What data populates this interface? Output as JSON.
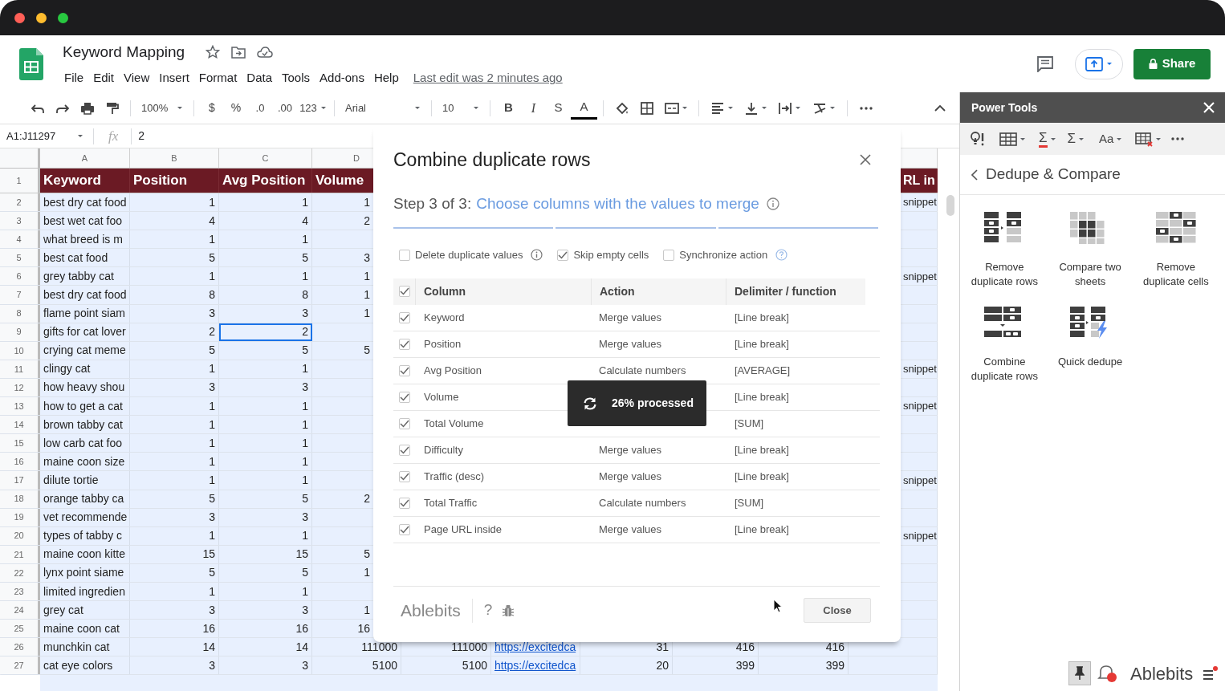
{
  "document": {
    "title": "Keyword Mapping",
    "menu": [
      "File",
      "Edit",
      "View",
      "Insert",
      "Format",
      "Data",
      "Tools",
      "Add-ons",
      "Help"
    ],
    "last_edit": "Last edit was 2 minutes ago",
    "share": "Share"
  },
  "toolbar": {
    "zoom": "100%",
    "currency": "$",
    "percent": "%",
    "decrease_decimals": ".0",
    "increase_decimals": ".00",
    "number_format": "123",
    "font": "Arial",
    "font_size": "10",
    "bold": "B",
    "italic": "I",
    "strikethrough": "S",
    "text_color": "A"
  },
  "formula_bar": {
    "name_box": "A1:J11297",
    "fx": "fx",
    "formula": "2"
  },
  "sheet": {
    "columns": [
      "A",
      "B",
      "C",
      "D"
    ],
    "header_row": {
      "number": "1",
      "cells": {
        "A": "Keyword",
        "B": "Position",
        "C": "Avg Position",
        "D": "Volume",
        "J": "RL in"
      }
    },
    "rows": [
      {
        "number": "2",
        "selected": false,
        "cells": {
          "A": "best dry cat food",
          "B": "1",
          "C": "1",
          "D": "1",
          "J": "snippet"
        }
      },
      {
        "number": "3",
        "selected": false,
        "cells": {
          "A": "best wet cat foo",
          "B": "4",
          "C": "4",
          "D": "2"
        }
      },
      {
        "number": "4",
        "selected": false,
        "cells": {
          "A": "what breed is m",
          "B": "1",
          "C": "1"
        }
      },
      {
        "number": "5",
        "selected": false,
        "cells": {
          "A": "best cat food",
          "B": "5",
          "C": "5",
          "D": "3"
        }
      },
      {
        "number": "6",
        "selected": false,
        "cells": {
          "A": "grey tabby cat",
          "B": "1",
          "C": "1",
          "D": "1",
          "J": "snippet"
        }
      },
      {
        "number": "7",
        "selected": false,
        "cells": {
          "A": "best dry cat food",
          "B": "8",
          "C": "8",
          "D": "1"
        }
      },
      {
        "number": "8",
        "selected": false,
        "cells": {
          "A": "flame point siam",
          "B": "3",
          "C": "3",
          "D": "1"
        }
      },
      {
        "number": "9",
        "selected": true,
        "cells": {
          "A": "gifts for cat lover",
          "B": "2",
          "C": "2"
        }
      },
      {
        "number": "10",
        "selected": false,
        "cells": {
          "A": "crying cat meme",
          "B": "5",
          "C": "5",
          "D": "5"
        }
      },
      {
        "number": "11",
        "selected": false,
        "cells": {
          "A": "clingy cat",
          "B": "1",
          "C": "1",
          "J": "snippet"
        }
      },
      {
        "number": "12",
        "selected": false,
        "cells": {
          "A": "how heavy shou",
          "B": "3",
          "C": "3"
        }
      },
      {
        "number": "13",
        "selected": false,
        "cells": {
          "A": "how to get a cat",
          "B": "1",
          "C": "1",
          "J": "snippet"
        }
      },
      {
        "number": "14",
        "selected": false,
        "cells": {
          "A": "brown tabby cat",
          "B": "1",
          "C": "1"
        }
      },
      {
        "number": "15",
        "selected": false,
        "cells": {
          "A": "low carb cat foo",
          "B": "1",
          "C": "1"
        }
      },
      {
        "number": "16",
        "selected": false,
        "cells": {
          "A": "maine coon size",
          "B": "1",
          "C": "1"
        }
      },
      {
        "number": "17",
        "selected": false,
        "cells": {
          "A": "dilute tortie",
          "B": "1",
          "C": "1",
          "J": "snippet"
        }
      },
      {
        "number": "18",
        "selected": false,
        "cells": {
          "A": "orange tabby ca",
          "B": "5",
          "C": "5",
          "D": "2"
        }
      },
      {
        "number": "19",
        "selected": false,
        "cells": {
          "A": "vet recommende",
          "B": "3",
          "C": "3"
        }
      },
      {
        "number": "20",
        "selected": false,
        "cells": {
          "A": "types of tabby c",
          "B": "1",
          "C": "1",
          "J": "snippet"
        }
      },
      {
        "number": "21",
        "selected": false,
        "cells": {
          "A": "maine coon kitte",
          "B": "15",
          "C": "15",
          "D": "5"
        }
      },
      {
        "number": "22",
        "selected": false,
        "cells": {
          "A": "lynx point siame",
          "B": "5",
          "C": "5",
          "D": "1"
        }
      },
      {
        "number": "23",
        "selected": false,
        "cells": {
          "A": "limited ingredien",
          "B": "1",
          "C": "1"
        }
      },
      {
        "number": "24",
        "selected": false,
        "cells": {
          "A": "grey cat",
          "B": "3",
          "C": "3",
          "D": "1"
        }
      },
      {
        "number": "25",
        "selected": false,
        "cells": {
          "A": "maine coon cat",
          "B": "16",
          "C": "16",
          "D": "16"
        }
      },
      {
        "number": "26",
        "selected": false,
        "cells": {
          "A": "munchkin cat",
          "B": "14",
          "C": "14",
          "D": "111000",
          "E": "111000",
          "F": "https://excitedca",
          "G": "31",
          "H": "416",
          "I": "416"
        }
      },
      {
        "number": "27",
        "selected": false,
        "cells": {
          "A": "cat eye colors",
          "B": "3",
          "C": "3",
          "D": "5100",
          "E": "5100",
          "F": "https://excitedca",
          "G": "20",
          "H": "399",
          "I": "399"
        }
      }
    ]
  },
  "dialog": {
    "title": "Combine duplicate rows",
    "step": "Step 3 of 3:",
    "step_title": "Choose columns with the values to merge",
    "options": [
      {
        "label": "Delete duplicate values",
        "checked": false,
        "kind": "info"
      },
      {
        "label": "Skip empty cells",
        "checked": true,
        "kind": "plain"
      },
      {
        "label": "Synchronize action",
        "checked": false,
        "kind": "help"
      }
    ],
    "columns": [
      "Column",
      "Action",
      "Delimiter / function"
    ],
    "all_checked": true,
    "rows": [
      {
        "column": "Keyword",
        "action": "Merge values",
        "delimiter": "[Line break]",
        "checked": true
      },
      {
        "column": "Position",
        "action": "Merge values",
        "delimiter": "[Line break]",
        "checked": true
      },
      {
        "column": "Avg Position",
        "action": "Calculate numbers",
        "delimiter": "[AVERAGE]",
        "checked": true
      },
      {
        "column": "Volume",
        "delimiter": "[Line break]",
        "checked": true
      },
      {
        "column": "Total Volume",
        "delimiter": "[SUM]",
        "checked": true
      },
      {
        "column": "Difficulty",
        "action": "Merge values",
        "delimiter": "[Line break]",
        "checked": true
      },
      {
        "column": "Traffic (desc)",
        "action": "Merge values",
        "delimiter": "[Line break]",
        "checked": true
      },
      {
        "column": "Total Traffic",
        "action": "Calculate numbers",
        "delimiter": "[SUM]",
        "checked": true
      },
      {
        "column": "Page URL inside",
        "action": "Merge values",
        "delimiter": "[Line break]",
        "checked": true
      }
    ],
    "progress": "26% processed",
    "brand": "Ablebits",
    "help": "?",
    "close": "Close"
  },
  "power_tools": {
    "title": "Power Tools",
    "toolbar_labels": [
      "Σ",
      "Σ",
      "Aa"
    ],
    "section": "Dedupe & Compare",
    "tools": [
      {
        "label": "Remove duplicate rows"
      },
      {
        "label": "Compare two sheets"
      },
      {
        "label": "Remove duplicate cells"
      },
      {
        "label": "Combine duplicate rows"
      },
      {
        "label": "Quick dedupe"
      }
    ],
    "brand": "Ablebits"
  }
}
